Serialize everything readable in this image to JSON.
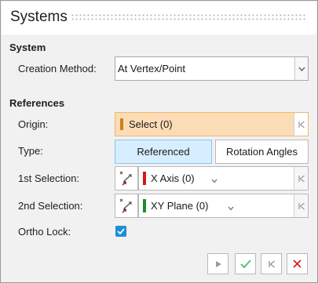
{
  "header": {
    "title": "Systems"
  },
  "system": {
    "heading": "System",
    "creation_method_label": "Creation Method:",
    "creation_method_value": "At Vertex/Point"
  },
  "references": {
    "heading": "References",
    "origin_label": "Origin:",
    "origin_value": "Select (0)",
    "type_label": "Type:",
    "type_options": [
      "Referenced",
      "Rotation Angles"
    ],
    "type_selected": "Referenced",
    "first_label": "1st Selection:",
    "first_value": "X Axis (0)",
    "first_color": "#d11a1a",
    "second_label": "2nd Selection:",
    "second_value": "XY Plane (0)",
    "second_color": "#1e8c2e",
    "ortho_label": "Ortho Lock:",
    "ortho_checked": true
  },
  "footer": {
    "buttons": [
      "play-icon",
      "check-icon",
      "skip-back-icon",
      "close-icon"
    ]
  },
  "colors": {
    "origin_fill": "#fcdcb6",
    "origin_marker": "#c9841a",
    "active_tab": "#d6eeff",
    "checkbox": "#1b8fd6",
    "close": "#d32222",
    "check": "#58c06b"
  }
}
